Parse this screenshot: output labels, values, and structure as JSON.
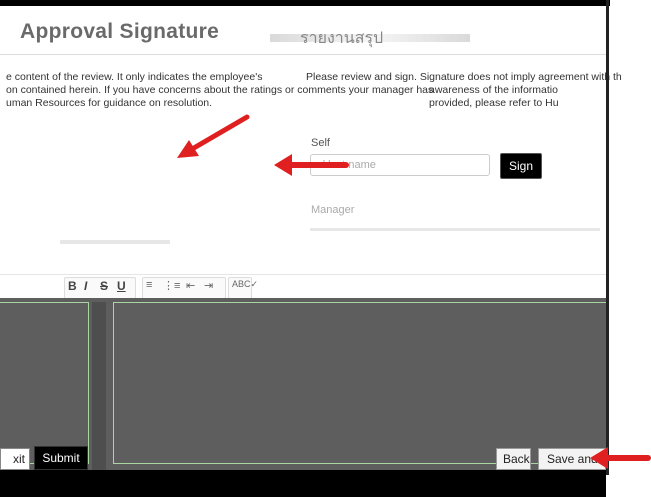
{
  "header": {
    "title": "Approval Signature",
    "title_right": "รายงานสรุป"
  },
  "description": {
    "left_line_1": "e content of the review. It only indicates the employee's",
    "left_line_2": "on contained herein. If you have concerns about the ratings or comments your manager has",
    "left_line_3": "uman Resources for guidance on resolution.",
    "right_line_1": "Please review and sign. Signature does not imply agreement with th",
    "right_line_2": "awareness of the informatio",
    "right_line_3": "provided, please refer to Hu"
  },
  "self_section": {
    "label": "Self",
    "input_placeholder": "Enter first and last name",
    "input_visible_text": "d last name",
    "sign_button": "Sign"
  },
  "manager_section": {
    "label": "Manager"
  },
  "toolbar": {
    "bold": "B",
    "italic": "I",
    "strike": "S",
    "underline": "U",
    "ordered_list_icon": "ordered-list-icon",
    "bullet_list_icon": "bullet-list-icon",
    "outdent_icon": "outdent-icon",
    "indent_icon": "indent-icon",
    "spellcheck_icon": "spellcheck-icon"
  },
  "footer": {
    "exit_button": "xit",
    "submit_button": "Submit",
    "back_button": "Back",
    "save_button": "Save and"
  },
  "annotations": {
    "arrow_color": "#e02020"
  }
}
